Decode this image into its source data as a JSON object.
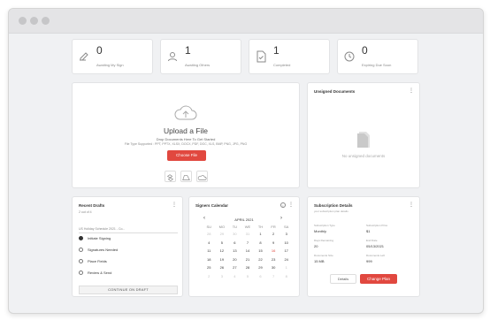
{
  "stats": [
    {
      "value": "0",
      "label": "Awaiting My Sign",
      "icon": "pen-paper-icon"
    },
    {
      "value": "1",
      "label": "Awaiting Others",
      "icon": "user-icon"
    },
    {
      "value": "1",
      "label": "Completed",
      "icon": "document-check-icon"
    },
    {
      "value": "0",
      "label": "Expiring Due Soon",
      "icon": "clock-icon"
    }
  ],
  "upload": {
    "title": "Upload a File",
    "subtitle": "Drop Documents Here To Get Started",
    "types": "File Type Supported : PPT, PPTX, XLSX, DOCX, PDF, DOC, XLS, BMP, PNG, JPG, PNG",
    "choose_label": "Choose File"
  },
  "unsigned": {
    "title": "Unsigned Documents",
    "empty": "No unsigned documents"
  },
  "drafts": {
    "title": "Recent Drafts",
    "count": "2 out of 4",
    "selected": "US Holiday Schedule 2021 - Co...",
    "steps": [
      {
        "label": "Initiate Signing",
        "done": true
      },
      {
        "label": "Signatures Needed",
        "done": false
      },
      {
        "label": "Place Fields",
        "done": false
      },
      {
        "label": "Review & Send",
        "done": false
      }
    ],
    "continue_label": "CONTINUE ON DRAFT"
  },
  "calendar": {
    "title": "Signers Calendar",
    "month": "APRIL 2021",
    "weekdays": [
      "SU",
      "MO",
      "TU",
      "WE",
      "TH",
      "FR",
      "SA"
    ],
    "weeks": [
      [
        "28",
        "29",
        "30",
        "31",
        "1",
        "2",
        "3"
      ],
      [
        "4",
        "5",
        "6",
        "7",
        "8",
        "9",
        "10"
      ],
      [
        "11",
        "12",
        "13",
        "14",
        "15",
        "16",
        "17"
      ],
      [
        "18",
        "19",
        "20",
        "21",
        "22",
        "23",
        "24"
      ],
      [
        "25",
        "26",
        "27",
        "28",
        "29",
        "30",
        "1"
      ],
      [
        "2",
        "3",
        "4",
        "5",
        "6",
        "7",
        "8"
      ]
    ],
    "today": "16",
    "accent": "#e1483f"
  },
  "subscription": {
    "title": "Subscription Details",
    "subtitle": "your subscription plan details",
    "fields": [
      {
        "key": "Subscription Type",
        "value": "Monthly"
      },
      {
        "key": "Subscription Price",
        "value": "$1"
      },
      {
        "key": "Days Remaining",
        "value": "20"
      },
      {
        "key": "End Date",
        "value": "05/13/2021"
      },
      {
        "key": "Documents Size",
        "value": "15 MB"
      },
      {
        "key": "Documents Left",
        "value": "999"
      }
    ],
    "details_label": "Details",
    "change_label": "Change Plan"
  }
}
